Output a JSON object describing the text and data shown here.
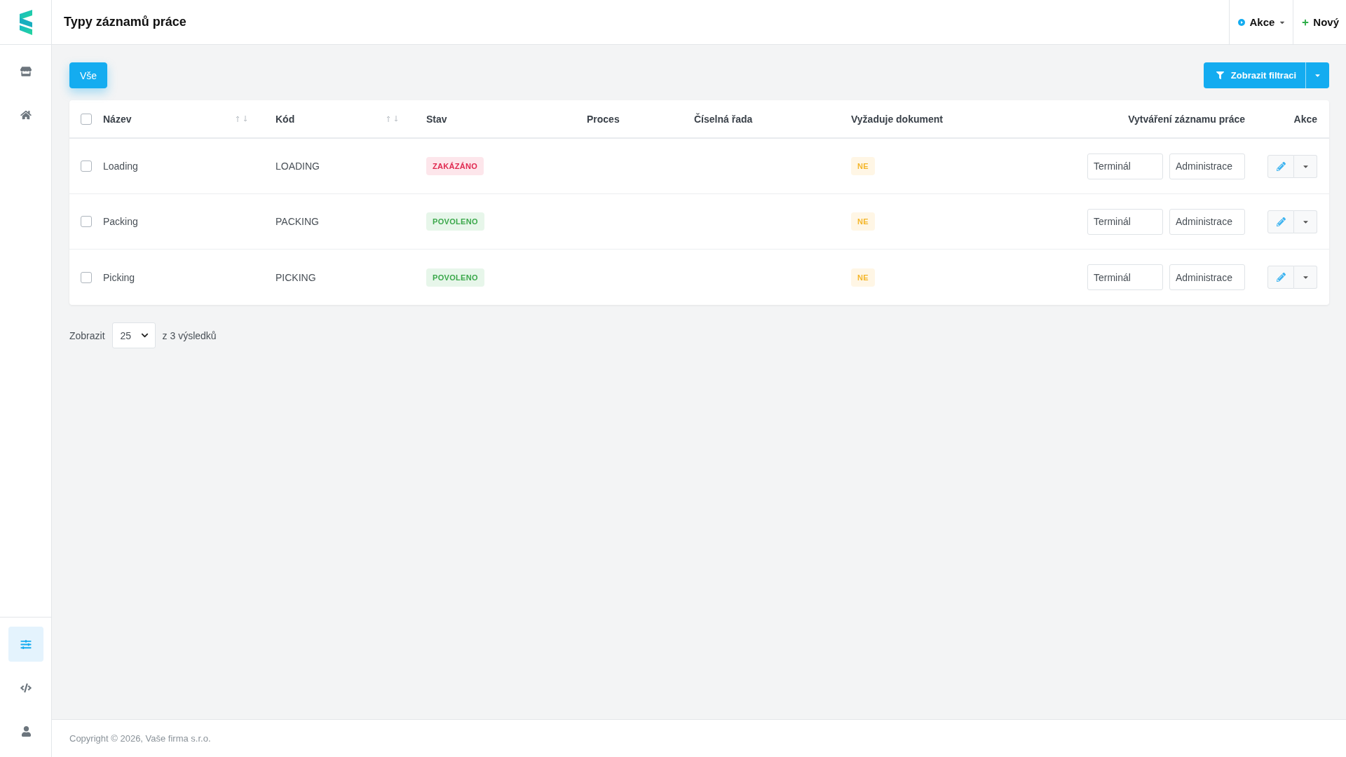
{
  "sidebar": {
    "top_items": [
      {
        "selected": false
      },
      {
        "selected": false
      }
    ],
    "bottom_items": [
      {
        "selected": true
      },
      {
        "selected": false
      },
      {
        "selected": false
      }
    ]
  },
  "header": {
    "title": "Typy záznamů práce",
    "actions": [
      {
        "kind": "menu",
        "label": "Akce"
      },
      {
        "kind": "create",
        "label": "Nový"
      }
    ]
  },
  "toolbar": {
    "views": [
      {
        "label": "Vše",
        "selected": true
      }
    ],
    "filter_button": {
      "label": "Zobrazit filtraci"
    }
  },
  "table": {
    "select_all": {
      "checked": false
    },
    "columns": [
      {
        "label": "Název",
        "sortable": true
      },
      {
        "label": "Kód",
        "sortable": true
      },
      {
        "label": "Stav",
        "sortable": false
      },
      {
        "label": "Proces",
        "sortable": false
      },
      {
        "label": "Číselná řada",
        "sortable": false
      },
      {
        "label": "Vyžaduje dokument",
        "sortable": false
      },
      {
        "label": "Vytváření záznamu práce",
        "sortable": false
      },
      {
        "label": "Akce",
        "sortable": false
      }
    ],
    "rows": [
      {
        "checked": false,
        "name": "Loading",
        "code": "LOADING",
        "status": {
          "kind": "danger",
          "label": "ZAKÁZÁNO"
        },
        "requires_document": "NE",
        "creation_targets": [
          "Terminál",
          "Administrace"
        ]
      },
      {
        "checked": false,
        "name": "Packing",
        "code": "PACKING",
        "status": {
          "kind": "success",
          "label": "POVOLENO"
        },
        "requires_document": "NE",
        "creation_targets": [
          "Terminál",
          "Administrace"
        ]
      },
      {
        "checked": false,
        "name": "Picking",
        "code": "PICKING",
        "status": {
          "kind": "success",
          "label": "POVOLENO"
        },
        "requires_document": "NE",
        "creation_targets": [
          "Terminál",
          "Administrace"
        ]
      }
    ]
  },
  "pagination": {
    "label": "Zobrazit",
    "page_size": "25",
    "summary": "z 3 výsledků"
  },
  "footer": {
    "copyright": "Copyright © 2026, Vaše firma s.r.o."
  }
}
